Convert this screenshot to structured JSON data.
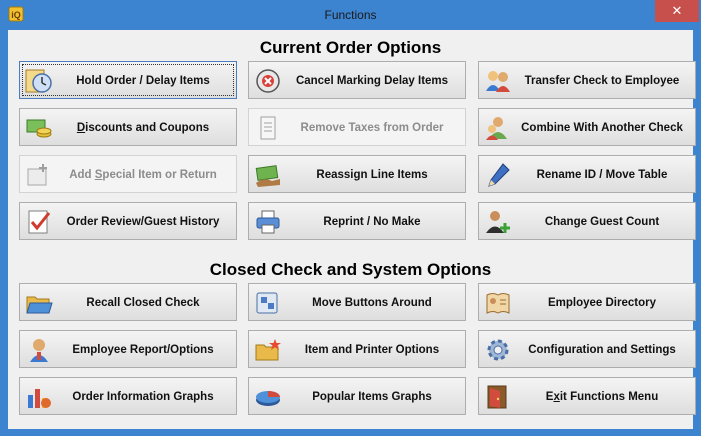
{
  "window": {
    "title": "Functions",
    "close_glyph": "✕",
    "app_icon": "functions-app-icon"
  },
  "sections": {
    "current": "Current Order Options",
    "closed": "Closed Check and System Options"
  },
  "buttons": {
    "hold_order": "Hold Order / Delay Items",
    "cancel_marking": "Cancel Marking Delay Items",
    "transfer_check": "Transfer Check to Employee",
    "discounts_pre": "D",
    "discounts_post": "iscounts and Coupons",
    "remove_taxes": "Remove Taxes from Order",
    "combine_check": "Combine With Another Check",
    "add_special_pre": "Add ",
    "add_special_u": "S",
    "add_special_post": "pecial Item or Return",
    "reassign_items": "Reassign Line Items",
    "rename_id": "Rename ID / Move Table",
    "order_review": "Order Review/Guest History",
    "reprint": "Reprint / No Make",
    "guest_count": "Change Guest Count",
    "recall_closed": "Recall Closed Check",
    "move_buttons": "Move Buttons Around",
    "employee_directory": "Employee Directory",
    "employee_report": "Employee Report/Options",
    "item_printer": "Item and Printer Options",
    "configuration": "Configuration and Settings",
    "order_graphs": "Order Information Graphs",
    "popular_graphs": "Popular Items Graphs",
    "exit_pre": "E",
    "exit_u": "x",
    "exit_post": "it Functions Menu"
  },
  "states": {
    "disabled": [
      "Remove Taxes from Order",
      "Add Special Item or Return"
    ],
    "focused": "Hold Order / Delay Items"
  },
  "colors": {
    "titlebar": "#3c83d0",
    "close_button": "#c7504c",
    "client": "#f0f0f0",
    "disabled_text": "#8c8c8c"
  }
}
